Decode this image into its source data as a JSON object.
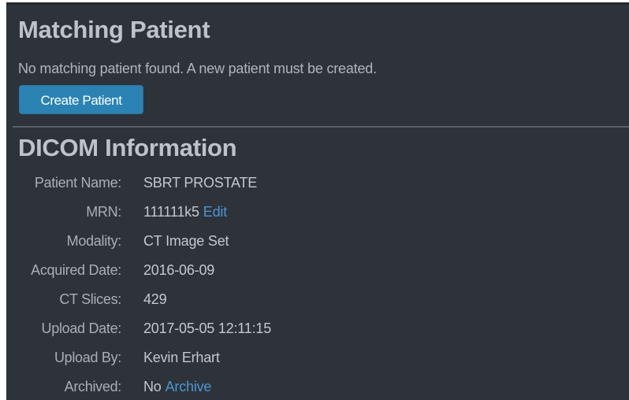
{
  "matching": {
    "title": "Matching Patient",
    "message": "No matching patient found. A new patient must be created.",
    "create_button": "Create Patient"
  },
  "dicom": {
    "title": "DICOM Information",
    "rows": [
      {
        "label": "Patient Name:",
        "value": "SBRT PROSTATE"
      },
      {
        "label": "MRN:",
        "value": "111111k5",
        "link": "Edit"
      },
      {
        "label": "Modality:",
        "value": "CT Image Set"
      },
      {
        "label": "Acquired Date:",
        "value": "2016-06-09"
      },
      {
        "label": "CT Slices:",
        "value": "429"
      },
      {
        "label": "Upload Date:",
        "value": "2017-05-05 12:11:15"
      },
      {
        "label": "Upload By:",
        "value": "Kevin Erhart"
      },
      {
        "label": "Archived:",
        "value": "No",
        "link": "Archive"
      }
    ]
  },
  "colors": {
    "panel_background": "#2d3339",
    "button": "#2a83b3",
    "link": "#4a96d2"
  }
}
